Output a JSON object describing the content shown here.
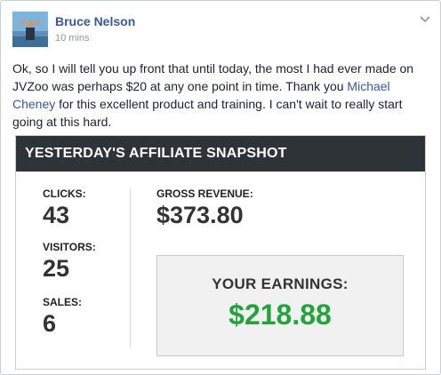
{
  "post": {
    "author": "Bruce Nelson",
    "time": "10 mins",
    "text_before_link": "Ok, so I will tell you up front that until today, the most I had ever made on JVZoo was perhaps $20 at any one point in time. Thank you ",
    "link_text": "Michael Cheney",
    "text_after_link": " for this excellent product and training. I can't wait to really start going at this hard."
  },
  "snapshot": {
    "title": "YESTERDAY'S AFFILIATE SNAPSHOT",
    "clicks_label": "CLICKS:",
    "clicks_value": "43",
    "visitors_label": "VISITORS:",
    "visitors_value": "25",
    "sales_label": "SALES:",
    "sales_value": "6",
    "gross_label": "GROSS REVENUE:",
    "gross_value": "$373.80",
    "earnings_label": "YOUR EARNINGS:",
    "earnings_value": "$218.88"
  },
  "colors": {
    "author": "#3b5998",
    "link": "#365899",
    "header_bg": "#2e3338",
    "earnings": "#23a33b"
  },
  "icons": [
    "avatar",
    "chevron-down-icon"
  ]
}
